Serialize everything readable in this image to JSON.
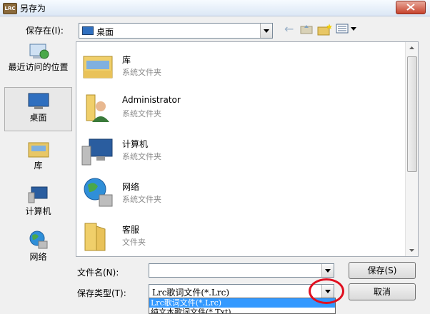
{
  "window": {
    "title": "另存为",
    "app_icon_text": "LRC"
  },
  "save_in": {
    "label": "保存在(I):",
    "value": "桌面"
  },
  "places": [
    {
      "label": "最近访问的位置"
    },
    {
      "label": "桌面"
    },
    {
      "label": "库"
    },
    {
      "label": "计算机"
    },
    {
      "label": "网络"
    }
  ],
  "files": [
    {
      "name": "库",
      "type": "系统文件夹"
    },
    {
      "name": "Administrator",
      "type": "系统文件夹"
    },
    {
      "name": "计算机",
      "type": "系统文件夹"
    },
    {
      "name": "网络",
      "type": "系统文件夹"
    },
    {
      "name": "客服",
      "type": "文件夹"
    }
  ],
  "filename": {
    "label": "文件名(N):",
    "value": ""
  },
  "filetype": {
    "label": "保存类型(T):",
    "value": "Lrc歌词文件(*.Lrc)",
    "options": [
      "Lrc歌词文件(*.Lrc)",
      "纯文本歌词文件(*.Txt)"
    ]
  },
  "buttons": {
    "save": "保存(S)",
    "cancel": "取消"
  },
  "colors": {
    "highlight": "#3399ff",
    "annotation": "#e01020"
  }
}
